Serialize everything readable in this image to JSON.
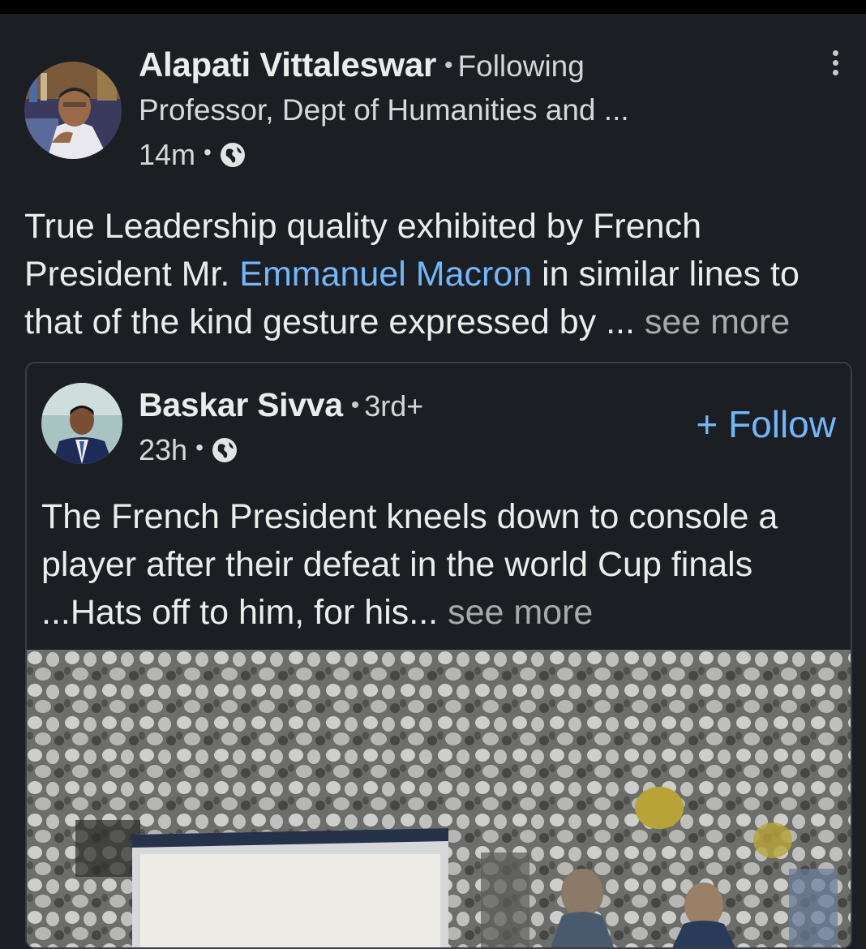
{
  "post": {
    "author": {
      "name": "Alapati Vittaleswar",
      "relation": "Following",
      "headline": "Professor, Dept of Humanities and ..."
    },
    "time": "14m",
    "visibility_icon": "globe-icon",
    "menu_icon": "more-vertical-icon",
    "text_before_mention": "True Leadership quality exhibited by French President Mr. ",
    "mention": "Emmanuel Macron",
    "text_after_mention": " in similar lines to that of the kind gesture expressed by ",
    "ellipsis": "...",
    "see_more": "see more"
  },
  "shared": {
    "author": {
      "name": "Baskar Sivva",
      "degree": "3rd+"
    },
    "time": "23h",
    "visibility_icon": "globe-icon",
    "follow_label": "+ Follow",
    "text": "The French President kneels down to console a player after their defeat in the world Cup finals ...Hats off to him, for his",
    "ellipsis": "...",
    "see_more": "see more",
    "media": "stadium-crowd-video-thumbnail"
  },
  "colors": {
    "background": "#1b1f23",
    "link": "#71b7fb",
    "muted": "#a9a9a9",
    "border": "#3a3e42"
  }
}
